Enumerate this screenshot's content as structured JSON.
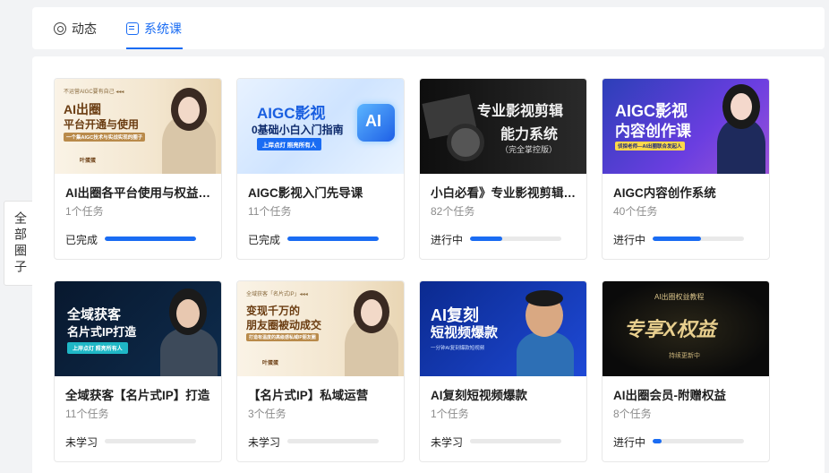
{
  "side_tab": {
    "label": "全部圈子"
  },
  "tabs": [
    {
      "label": "动态",
      "icon": "activity-icon",
      "active": false
    },
    {
      "label": "系统课",
      "icon": "course-icon",
      "active": true
    }
  ],
  "colors": {
    "accent": "#1a6cf3",
    "track": "#e9e9e9"
  },
  "courses": [
    {
      "title": "AI出圈各平台使用与权益说明",
      "tasks": "1个任务",
      "status": "已完成",
      "progress": 1.0,
      "cover": {
        "lines": [
          "不运营AIGC要有自己 ◂◂◂",
          "AI出圈",
          "平台开通与使用",
          "一个集AIGC技术与实战实现的圈子",
          "叶蛋蛋"
        ]
      }
    },
    {
      "title": "AIGC影视入门先导课",
      "tasks": "11个任务",
      "status": "已完成",
      "progress": 1.0,
      "cover": {
        "lines": [
          "AIGC影视",
          "0基础小白入门指南",
          "上岸点灯 照亮所有人",
          "AI"
        ]
      }
    },
    {
      "title": "小白必看》专业影视剪辑能力系统",
      "tasks": "82个任务",
      "status": "进行中",
      "progress": 0.35,
      "cover": {
        "lines": [
          "专业影视剪辑",
          "能力系统",
          "（完全掌控版）"
        ]
      }
    },
    {
      "title": "AIGC内容创作系统",
      "tasks": "40个任务",
      "status": "进行中",
      "progress": 0.53,
      "cover": {
        "lines": [
          "AIGC影视",
          "内容创作课",
          "侦探老师—AI出圈联合发起人"
        ]
      }
    },
    {
      "title": "全域获客【名片式IP】打造",
      "tasks": "11个任务",
      "status": "未学习",
      "progress": 0.0,
      "cover": {
        "lines": [
          "全域获客",
          "名片式IP打造",
          "上岸点灯 照亮所有人"
        ]
      }
    },
    {
      "title": "【名片式IP】私域运营",
      "tasks": "3个任务",
      "status": "未学习",
      "progress": 0.0,
      "cover": {
        "lines": [
          "全域获客「名片式IP」◂◂◂",
          "变现千万的",
          "朋友圈被动成交",
          "打造有温度的高级感私域IP朋友圈",
          "叶蛋蛋"
        ]
      }
    },
    {
      "title": "AI复刻短视频爆款",
      "tasks": "1个任务",
      "status": "未学习",
      "progress": 0.0,
      "cover": {
        "lines": [
          "AI复刻",
          "短视频爆款",
          "一分钟AI复刻爆款短视频"
        ]
      }
    },
    {
      "title": "AI出圈会员-附赠权益",
      "tasks": "8个任务",
      "status": "进行中",
      "progress": 0.1,
      "cover": {
        "lines": [
          "AI出圈权益教程",
          "专享X权益",
          "持续更新中"
        ]
      }
    }
  ]
}
